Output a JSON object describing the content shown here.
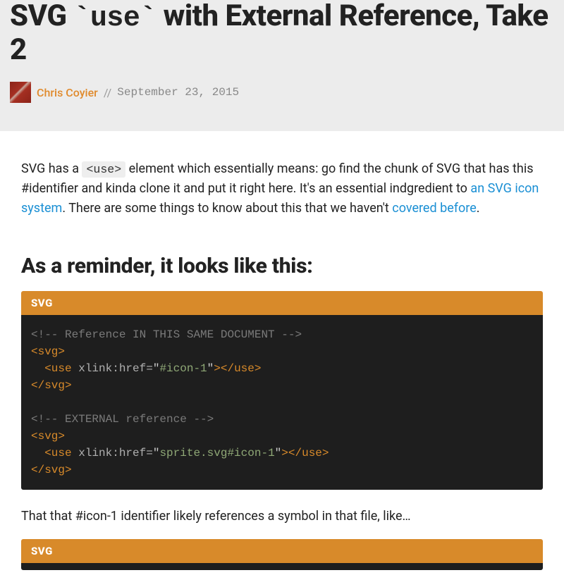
{
  "title_pre": "SVG ",
  "title_code": "`use`",
  "title_post": " with External Reference, Take 2",
  "author": "Chris Coyier",
  "separator": "//",
  "date": "September 23, 2015",
  "intro": {
    "t1": "SVG has a ",
    "code1": "<use>",
    "t2": " element which essentially means: go find the chunk of SVG that has this #identifier and kinda clone it and put it right here. It's an essential indgredient to ",
    "link1": "an SVG icon system",
    "t3": ". There are some things to know about this that we haven't ",
    "link2": "covered before",
    "t4": "."
  },
  "h2_reminder": "As a reminder, it looks like this:",
  "code_label": "SVG",
  "code1": {
    "comment1": "<!-- Reference IN THIS SAME DOCUMENT -->",
    "l2_open": "<svg>",
    "l3_open": "<use",
    "l3_attr": " xlink:href=",
    "l3_q1": "\"",
    "l3_val": "#icon-1",
    "l3_q2": "\"",
    "l3_close": "></use>",
    "l4_close": "</svg>",
    "comment2": "<!-- EXTERNAL reference -->",
    "l6_open": "<svg>",
    "l7_open": "<use",
    "l7_attr": " xlink:href=",
    "l7_q1": "\"",
    "l7_val": "sprite.svg#icon-1",
    "l7_q2": "\"",
    "l7_close": "></use>",
    "l8_close": "</svg>"
  },
  "para2": "That that #icon-1 identifier likely references a symbol in that file, like…",
  "code_label2": "SVG"
}
